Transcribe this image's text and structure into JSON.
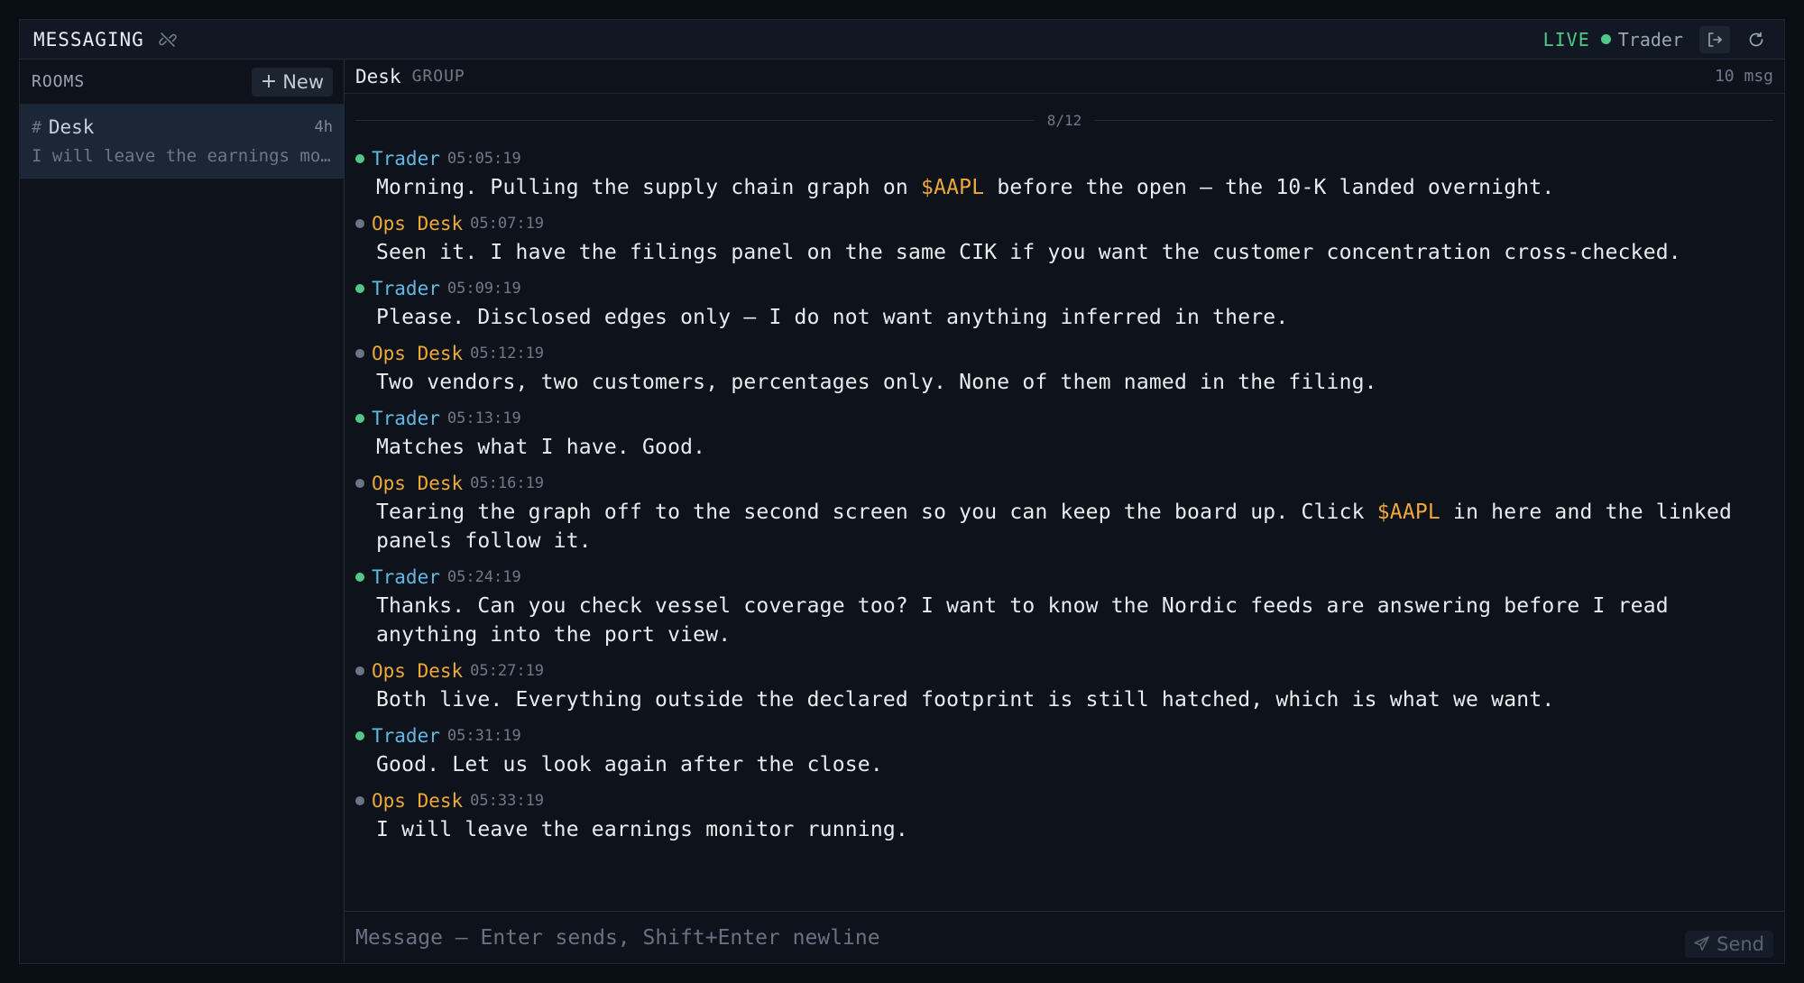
{
  "topbar": {
    "title": "MESSAGING",
    "icons": {
      "unlink": "unlink-icon",
      "logout": "logout-icon",
      "refresh": "refresh-icon"
    },
    "status": "LIVE",
    "user": "Trader"
  },
  "sidebar": {
    "header": "ROOMS",
    "new_label": "New",
    "rooms": [
      {
        "hash": "#",
        "name": "Desk",
        "age": "4h",
        "preview": "I will leave the earnings monitor running."
      }
    ]
  },
  "chat": {
    "room_name": "Desk",
    "room_type": "GROUP",
    "count": "10 msg",
    "date": "8/12",
    "messages": [
      {
        "author": "Trader",
        "time": "05:05:19",
        "parts": [
          "Morning. Pulling the supply chain graph on ",
          "$AAPL",
          " before the open — the 10-K landed overnight."
        ]
      },
      {
        "author": "Ops Desk",
        "time": "05:07:19",
        "parts": [
          "Seen it. I have the filings panel on the same CIK if you want the customer concentration cross-checked."
        ]
      },
      {
        "author": "Trader",
        "time": "05:09:19",
        "parts": [
          "Please. Disclosed edges only — I do not want anything inferred in there."
        ]
      },
      {
        "author": "Ops Desk",
        "time": "05:12:19",
        "parts": [
          "Two vendors, two customers, percentages only. None of them named in the filing."
        ]
      },
      {
        "author": "Trader",
        "time": "05:13:19",
        "parts": [
          "Matches what I have. Good."
        ]
      },
      {
        "author": "Ops Desk",
        "time": "05:16:19",
        "parts": [
          "Tearing the graph off to the second screen so you can keep the board up. Click ",
          "$AAPL",
          " in here and the linked panels follow it."
        ]
      },
      {
        "author": "Trader",
        "time": "05:24:19",
        "parts": [
          "Thanks. Can you check vessel coverage too? I want to know the Nordic feeds are answering before I read anything into the port view."
        ]
      },
      {
        "author": "Ops Desk",
        "time": "05:27:19",
        "parts": [
          "Both live. Everything outside the declared footprint is still hatched, which is what we want."
        ]
      },
      {
        "author": "Trader",
        "time": "05:31:19",
        "parts": [
          "Good. Let us look again after the close."
        ]
      },
      {
        "author": "Ops Desk",
        "time": "05:33:19",
        "parts": [
          "I will leave the earnings monitor running."
        ]
      }
    ]
  },
  "composer": {
    "placeholder": "Message — Enter sends, Shift+Enter newline",
    "send_label": "Send"
  },
  "colors": {
    "live": "#4ec98a",
    "trader": "#63b7e8",
    "ops": "#f0a83c",
    "ticker": "#f0a83c"
  }
}
